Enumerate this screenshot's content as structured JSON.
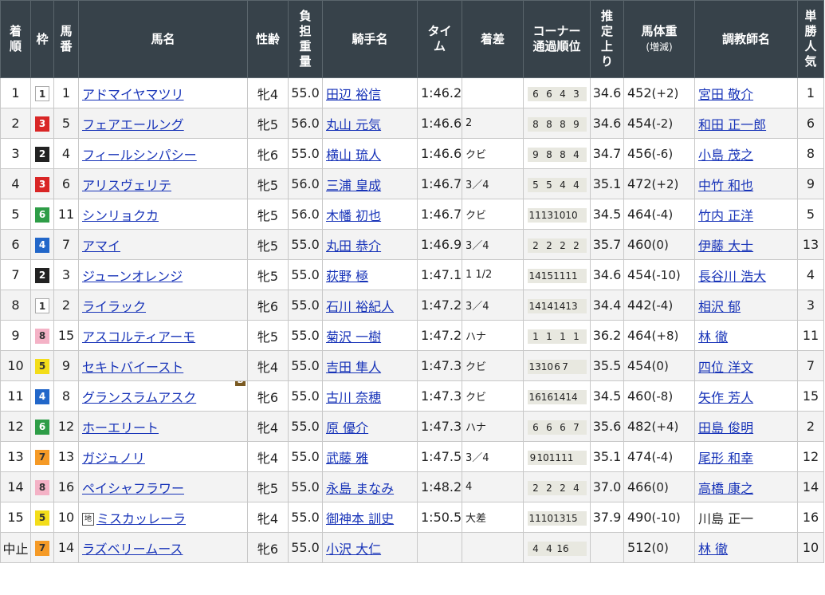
{
  "headers": {
    "rank": "着順",
    "waku": "枠",
    "umaban": "馬番",
    "horse": "馬名",
    "sexage": "性齢",
    "weight_burden": "負担重量",
    "jockey": "騎手名",
    "time": "タイム",
    "margin": "着差",
    "corner": "コーナー通過順位",
    "agari": "推定上り",
    "body_weight": "馬体重",
    "body_weight_sub": "(増減)",
    "trainer": "調教師名",
    "popularity": "単勝人気"
  },
  "rows": [
    {
      "rank": "1",
      "waku": "1",
      "umaban": "1",
      "horse": "アドマイヤマツリ",
      "sexage": "牝4",
      "burden": "55.0",
      "jockey": "田辺 裕信",
      "time": "1:46.2",
      "margin": "",
      "corner": [
        "6",
        "6",
        "4",
        "3"
      ],
      "agari": "34.6",
      "bw": "452",
      "bw_diff": "(+2)",
      "trainer": "宮田 敬介",
      "pop": "1"
    },
    {
      "rank": "2",
      "waku": "3",
      "umaban": "5",
      "horse": "フェアエールング",
      "sexage": "牝5",
      "burden": "56.0",
      "jockey": "丸山 元気",
      "time": "1:46.6",
      "margin": "2",
      "corner": [
        "8",
        "8",
        "8",
        "9"
      ],
      "agari": "34.6",
      "bw": "454",
      "bw_diff": "(-2)",
      "trainer": "和田 正一郎",
      "pop": "6"
    },
    {
      "rank": "3",
      "waku": "2",
      "umaban": "4",
      "horse": "フィールシンパシー",
      "sexage": "牝6",
      "burden": "55.0",
      "jockey": "横山 琉人",
      "time": "1:46.6",
      "margin": "クビ",
      "corner": [
        "9",
        "8",
        "8",
        "4"
      ],
      "agari": "34.7",
      "bw": "456",
      "bw_diff": "(-6)",
      "trainer": "小島 茂之",
      "pop": "8"
    },
    {
      "rank": "4",
      "waku": "3",
      "umaban": "6",
      "horse": "アリスヴェリテ",
      "sexage": "牝5",
      "burden": "56.0",
      "jockey": "三浦 皇成",
      "time": "1:46.7",
      "margin": "3／4",
      "corner": [
        "5",
        "5",
        "4",
        "4"
      ],
      "agari": "35.1",
      "bw": "472",
      "bw_diff": "(+2)",
      "trainer": "中竹 和也",
      "pop": "9"
    },
    {
      "rank": "5",
      "waku": "6",
      "umaban": "11",
      "horse": "シンリョクカ",
      "sexage": "牝5",
      "burden": "56.0",
      "jockey": "木幡 初也",
      "time": "1:46.7",
      "margin": "クビ",
      "corner": [
        "11",
        "13",
        "10",
        "10"
      ],
      "agari": "34.5",
      "bw": "464",
      "bw_diff": "(-4)",
      "trainer": "竹内 正洋",
      "pop": "5"
    },
    {
      "rank": "6",
      "waku": "4",
      "umaban": "7",
      "horse": "アマイ",
      "sexage": "牝5",
      "burden": "55.0",
      "jockey": "丸田 恭介",
      "time": "1:46.9",
      "margin": "3／4",
      "corner": [
        "2",
        "2",
        "2",
        "2"
      ],
      "agari": "35.7",
      "bw": "460",
      "bw_diff": "(0)",
      "trainer": "伊藤 大士",
      "pop": "13"
    },
    {
      "rank": "7",
      "waku": "2",
      "umaban": "3",
      "horse": "ジューンオレンジ",
      "sexage": "牝5",
      "burden": "55.0",
      "jockey": "荻野 極",
      "time": "1:47.1",
      "margin": "1 1/2",
      "corner": [
        "14",
        "15",
        "11",
        "11"
      ],
      "agari": "34.6",
      "bw": "454",
      "bw_diff": "(-10)",
      "trainer": "長谷川 浩大",
      "pop": "4"
    },
    {
      "rank": "8",
      "waku": "1",
      "umaban": "2",
      "horse": "ライラック",
      "sexage": "牝6",
      "burden": "55.0",
      "jockey": "石川 裕紀人",
      "time": "1:47.2",
      "margin": "3／4",
      "corner": [
        "14",
        "14",
        "14",
        "13"
      ],
      "agari": "34.4",
      "bw": "442",
      "bw_diff": "(-4)",
      "trainer": "相沢 郁",
      "pop": "3"
    },
    {
      "rank": "9",
      "waku": "8",
      "umaban": "15",
      "horse": "アスコルティアーモ",
      "sexage": "牝5",
      "burden": "55.0",
      "jockey": "菊沢 一樹",
      "time": "1:47.2",
      "margin": "ハナ",
      "corner": [
        "1",
        "1",
        "1",
        "1"
      ],
      "agari": "36.2",
      "bw": "464",
      "bw_diff": "(+8)",
      "trainer": "林 徹",
      "pop": "11"
    },
    {
      "rank": "10",
      "waku": "5",
      "umaban": "9",
      "horse": "セキトバイースト",
      "sexage": "牝4",
      "burden": "55.0",
      "jockey": "吉田 隼人",
      "time": "1:47.3",
      "margin": "クビ",
      "corner": [
        "13",
        "10",
        "6",
        "7"
      ],
      "agari": "35.5",
      "bw": "454",
      "bw_diff": "(0)",
      "trainer": "四位 洋文",
      "pop": "7"
    },
    {
      "rank": "11",
      "waku": "4",
      "umaban": "8",
      "horse": "グランスラムアスク",
      "mark": "B",
      "sexage": "牝6",
      "burden": "55.0",
      "jockey": "古川 奈穂",
      "time": "1:47.3",
      "margin": "クビ",
      "corner": [
        "16",
        "16",
        "14",
        "14"
      ],
      "agari": "34.5",
      "bw": "460",
      "bw_diff": "(-8)",
      "trainer": "矢作 芳人",
      "pop": "15"
    },
    {
      "rank": "12",
      "waku": "6",
      "umaban": "12",
      "horse": "ホーエリート",
      "sexage": "牝4",
      "burden": "55.0",
      "jockey": "原 優介",
      "time": "1:47.3",
      "margin": "ハナ",
      "corner": [
        "6",
        "6",
        "6",
        "7"
      ],
      "agari": "35.6",
      "bw": "482",
      "bw_diff": "(+4)",
      "trainer": "田島 俊明",
      "pop": "2"
    },
    {
      "rank": "13",
      "waku": "7",
      "umaban": "13",
      "horse": "ガジュノリ",
      "sexage": "牝4",
      "burden": "55.0",
      "jockey": "武藤 雅",
      "time": "1:47.5",
      "margin": "3／4",
      "corner": [
        "9",
        "10",
        "11",
        "11"
      ],
      "agari": "35.1",
      "bw": "474",
      "bw_diff": "(-4)",
      "trainer": "尾形 和幸",
      "pop": "12"
    },
    {
      "rank": "14",
      "waku": "8",
      "umaban": "16",
      "horse": "ペイシャフラワー",
      "sexage": "牝5",
      "burden": "55.0",
      "jockey": "永島 まなみ",
      "time": "1:48.2",
      "margin": "4",
      "corner": [
        "2",
        "2",
        "2",
        "4"
      ],
      "agari": "37.0",
      "bw": "466",
      "bw_diff": "(0)",
      "trainer": "高橋 康之",
      "pop": "14"
    },
    {
      "rank": "15",
      "waku": "5",
      "umaban": "10",
      "horse": "ミスカッレーラ",
      "prefix": "地",
      "sexage": "牝4",
      "burden": "55.0",
      "jockey": "御神本 訓史",
      "time": "1:50.5",
      "margin": "大差",
      "corner": [
        "11",
        "10",
        "13",
        "15"
      ],
      "agari": "37.9",
      "bw": "490",
      "bw_diff": "(-10)",
      "trainer": "川島 正一",
      "trainer_nolink": true,
      "pop": "16"
    },
    {
      "rank": "中止",
      "waku": "7",
      "umaban": "14",
      "horse": "ラズベリームース",
      "sexage": "牝6",
      "burden": "55.0",
      "jockey": "小沢 大仁",
      "time": "",
      "margin": "",
      "corner": [
        "4",
        "4",
        "16"
      ],
      "agari": "",
      "bw": "512",
      "bw_diff": "(0)",
      "trainer": "林 徹",
      "pop": "10"
    }
  ]
}
